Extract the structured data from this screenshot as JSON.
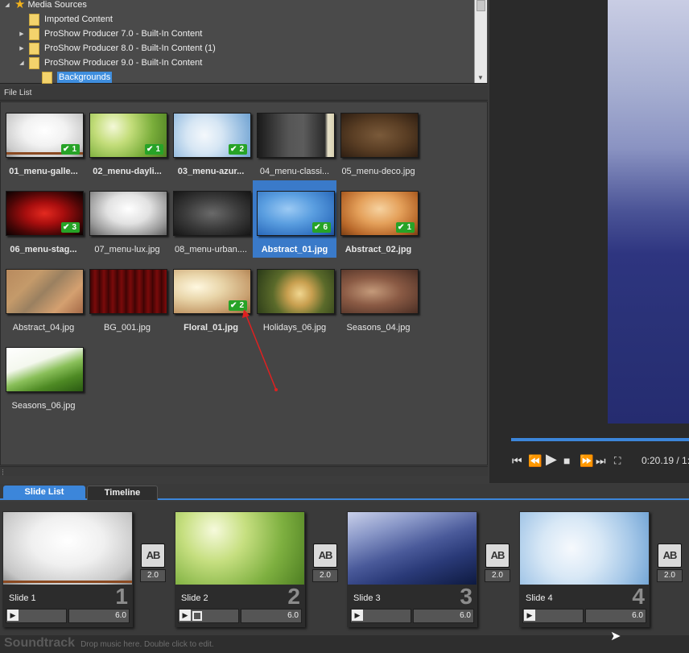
{
  "folder_tree": {
    "items": [
      {
        "label": "Media Sources",
        "arrow": "◢",
        "icon": "star-icon",
        "selected": false
      },
      {
        "label": "Imported Content",
        "arrow": "",
        "icon": "folder-icon",
        "selected": false
      },
      {
        "label": "ProShow Producer 7.0 - Built-In Content",
        "arrow": "▶",
        "icon": "folder-icon",
        "selected": false
      },
      {
        "label": "ProShow Producer 8.0 - Built-In Content (1)",
        "arrow": "▶",
        "icon": "folder-icon",
        "selected": false
      },
      {
        "label": "ProShow Producer 9.0 - Built-In Content",
        "arrow": "◢",
        "icon": "folder-icon",
        "selected": false
      },
      {
        "label": "Backgrounds",
        "arrow": "",
        "icon": "folder-icon",
        "selected": true
      }
    ]
  },
  "file_list": {
    "header": "File List",
    "files": [
      {
        "name": "01_menu-galle...",
        "badge": "1",
        "used": true,
        "selected": false
      },
      {
        "name": "02_menu-dayli...",
        "badge": "1",
        "used": true,
        "selected": false
      },
      {
        "name": "03_menu-azur...",
        "badge": "2",
        "used": true,
        "selected": false
      },
      {
        "name": "04_menu-classi...",
        "badge": "",
        "used": false,
        "selected": false
      },
      {
        "name": "05_menu-deco.jpg",
        "badge": "",
        "used": false,
        "selected": false
      },
      {
        "name": "06_menu-stag...",
        "badge": "3",
        "used": true,
        "selected": false
      },
      {
        "name": "07_menu-lux.jpg",
        "badge": "",
        "used": false,
        "selected": false
      },
      {
        "name": "08_menu-urban....",
        "badge": "",
        "used": false,
        "selected": false
      },
      {
        "name": "Abstract_01.jpg",
        "badge": "6",
        "used": true,
        "selected": true
      },
      {
        "name": "Abstract_02.jpg",
        "badge": "1",
        "used": true,
        "selected": false
      },
      {
        "name": "Abstract_04.jpg",
        "badge": "",
        "used": false,
        "selected": false
      },
      {
        "name": "BG_001.jpg",
        "badge": "",
        "used": false,
        "selected": false
      },
      {
        "name": "Floral_01.jpg",
        "badge": "2",
        "used": true,
        "selected": false
      },
      {
        "name": "Holidays_06.jpg",
        "badge": "",
        "used": false,
        "selected": false
      },
      {
        "name": "Seasons_04.jpg",
        "badge": "",
        "used": false,
        "selected": false
      },
      {
        "name": "Seasons_06.jpg",
        "badge": "",
        "used": false,
        "selected": false
      }
    ]
  },
  "preview": {
    "timecode": "0:20.19 / 1:",
    "controls": [
      "skip-back-icon",
      "rewind-icon",
      "play-icon",
      "stop-icon",
      "fast-forward-icon",
      "skip-forward-icon",
      "fullscreen-icon"
    ]
  },
  "tabs": [
    {
      "label": "Slide List",
      "active": true
    },
    {
      "label": "Timeline",
      "active": false
    }
  ],
  "slides": [
    {
      "label": "Slide 1",
      "number": "1",
      "duration": "6.0",
      "transition": "2.0",
      "multi_layer": false
    },
    {
      "label": "Slide 2",
      "number": "2",
      "duration": "6.0",
      "transition": "2.0",
      "multi_layer": true
    },
    {
      "label": "Slide 3",
      "number": "3",
      "duration": "6.0",
      "transition": "2.0",
      "multi_layer": false
    },
    {
      "label": "Slide 4",
      "number": "4",
      "duration": "6.0",
      "transition": "2.0",
      "multi_layer": false
    }
  ],
  "transition_label": "AB",
  "soundtrack": {
    "title": "Soundtrack",
    "hint": "Drop music here.  Double click to edit."
  },
  "colors": {
    "accent": "#3c86da",
    "badge": "#27a327",
    "folder": "#f3d36c",
    "annotation_arrow": "#e02020"
  }
}
